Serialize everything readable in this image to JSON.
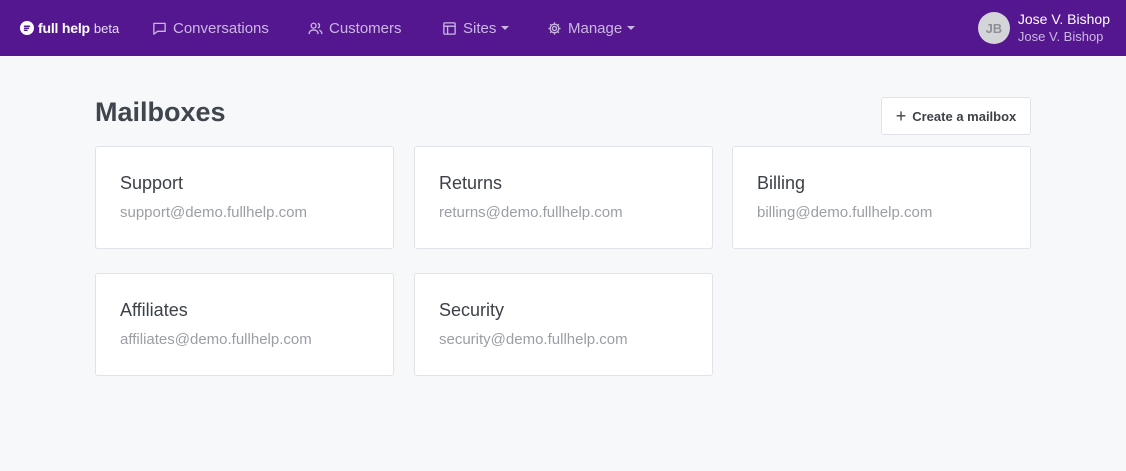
{
  "brand": {
    "name": "full help",
    "tag": "beta"
  },
  "nav": {
    "conversations": "Conversations",
    "customers": "Customers",
    "sites": "Sites",
    "manage": "Manage"
  },
  "user": {
    "initials": "JB",
    "name": "Jose V. Bishop",
    "account": "Jose V. Bishop"
  },
  "page": {
    "title": "Mailboxes",
    "create_label": "Create a mailbox"
  },
  "mailboxes": [
    {
      "name": "Support",
      "email": "support@demo.fullhelp.com"
    },
    {
      "name": "Returns",
      "email": "returns@demo.fullhelp.com"
    },
    {
      "name": "Billing",
      "email": "billing@demo.fullhelp.com"
    },
    {
      "name": "Affiliates",
      "email": "affiliates@demo.fullhelp.com"
    },
    {
      "name": "Security",
      "email": "security@demo.fullhelp.com"
    }
  ],
  "colors": {
    "header": "#55178f",
    "background": "#f7f8fa",
    "nav_text": "#cbb8e2"
  },
  "icons": {
    "brand": "fullhelp-logo-icon",
    "conversations": "chat-bubble-icon",
    "customers": "users-icon",
    "sites": "layout-icon",
    "manage": "gear-icon",
    "create": "plus-icon"
  }
}
